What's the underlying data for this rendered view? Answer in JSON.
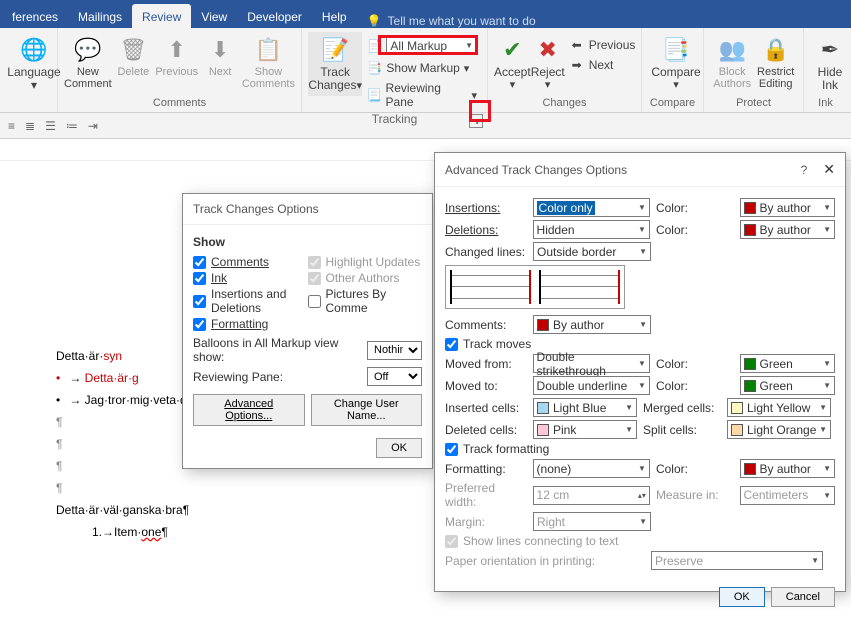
{
  "tabs": [
    "ferences",
    "Mailings",
    "Review",
    "View",
    "Developer",
    "Help"
  ],
  "active_tab": "Review",
  "tell_me": "Tell me what you want to do",
  "ribbon": {
    "language": {
      "label": "Language",
      "drop": "▾"
    },
    "new_comment": "New Comment",
    "delete": "Delete",
    "previous": "Previous",
    "next": "Next",
    "show_comments": "Show Comments",
    "comments_group": "Comments",
    "track_changes": "Track Changes",
    "markup": "All Markup",
    "show_markup": "Show Markup",
    "reviewing_pane": "Reviewing Pane",
    "tracking_group": "Tracking",
    "accept": "Accept",
    "reject": "Reject",
    "prev2": "Previous",
    "next2": "Next",
    "changes_group": "Changes",
    "compare": "Compare",
    "compare_group": "Compare",
    "block_authors": "Block Authors",
    "restrict": "Restrict Editing",
    "protect_group": "Protect",
    "hide_ink": "Hide Ink",
    "ink_group": "Ink"
  },
  "doc": {
    "l1a": "Detta·är·",
    "l1b": "syn",
    "l2": "Detta·är·g",
    "l3": "Jag·tror·mig·veta·detta.·",
    "l4": "Detta·är·väl·ganska·bra¶",
    "l5": "1.→Item·",
    "l5b": "one",
    "l5c": "¶"
  },
  "tco": {
    "title": "Track Changes Options",
    "show": "Show",
    "comments": "Comments",
    "ink": "Ink",
    "ins_del": "Insertions and Deletions",
    "formatting": "Formatting",
    "hl_updates": "Highlight Updates",
    "other_authors": "Other Authors",
    "pic_by": "Pictures By Comme",
    "balloons_lbl": "Balloons in All Markup view show:",
    "balloons_val": "Nothing",
    "rp_lbl": "Reviewing Pane:",
    "rp_val": "Off",
    "adv": "Advanced Options...",
    "chg_user": "Change User Name...",
    "ok": "OK"
  },
  "atco": {
    "title": "Advanced Track Changes Options",
    "insertions": "Insertions:",
    "ins_val": "Color only",
    "ins_color_lbl": "Color:",
    "ins_color": "By author",
    "deletions": "Deletions:",
    "del_val": "Hidden",
    "del_color_lbl": "Color:",
    "del_color": "By author",
    "changed_lines": "Changed lines:",
    "cl_val": "Outside border",
    "comments": "Comments:",
    "comments_val": "By author",
    "track_moves": "Track moves",
    "moved_from": "Moved from:",
    "mf_val": "Double strikethrough",
    "mf_color_lbl": "Color:",
    "mf_color": "Green",
    "moved_to": "Moved to:",
    "mt_val": "Double underline",
    "mt_color_lbl": "Color:",
    "mt_color": "Green",
    "ins_cells": "Inserted cells:",
    "ic_val": "Light Blue",
    "merged": "Merged cells:",
    "merged_val": "Light Yellow",
    "del_cells": "Deleted cells:",
    "dc_val": "Pink",
    "split": "Split cells:",
    "split_val": "Light Orange",
    "track_fmt": "Track formatting",
    "formatting": "Formatting:",
    "fmt_val": "(none)",
    "fmt_color_lbl": "Color:",
    "fmt_color": "By author",
    "pref_w": "Preferred width:",
    "pref_w_val": "12 cm",
    "measure": "Measure in:",
    "measure_val": "Centimeters",
    "margin": "Margin:",
    "margin_val": "Right",
    "show_lines": "Show lines connecting to text",
    "paper": "Paper orientation in printing:",
    "paper_val": "Preserve",
    "ok": "OK",
    "cancel": "Cancel"
  },
  "colors": {
    "red": "#c00000",
    "green": "#008000",
    "lblue": "#a8d8f0",
    "lyellow": "#fff7c0",
    "pink": "#ffc8d8",
    "lorange": "#ffd8a8"
  }
}
